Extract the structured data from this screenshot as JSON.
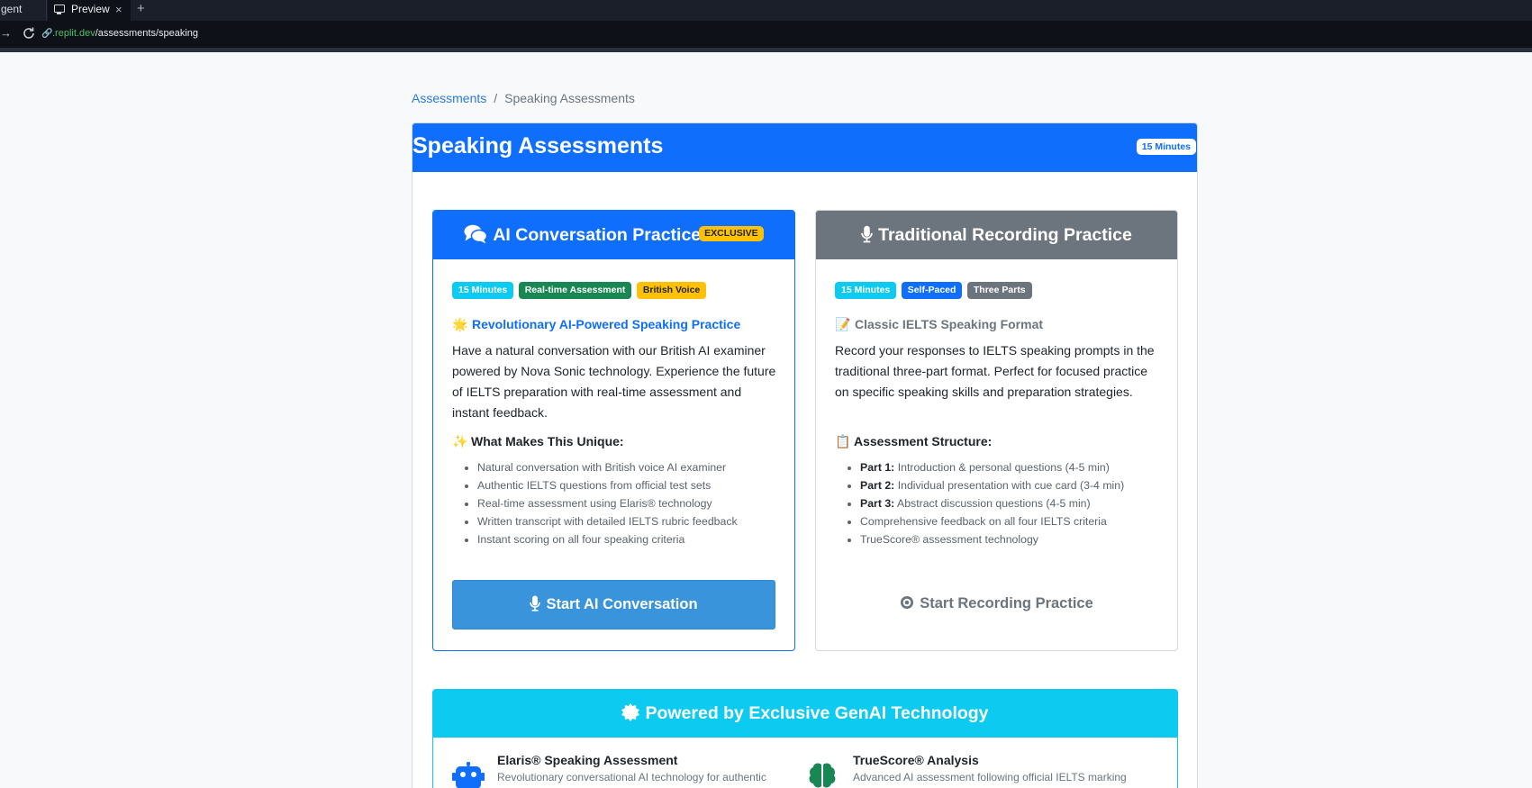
{
  "browser": {
    "partial_tab_label": "gent",
    "active_tab_label": "Preview",
    "tab_close": "×",
    "new_tab": "+",
    "forward_glyph": "→",
    "url_domain": ".replit.dev",
    "url_path": "/assessments/speaking"
  },
  "breadcrumb": {
    "root": "Assessments",
    "separator": "/",
    "current": "Speaking Assessments"
  },
  "main": {
    "title": "Speaking Assessments",
    "duration_badge": "15 Minutes"
  },
  "ai_option": {
    "title": "AI Conversation Practice",
    "exclusive_badge": "EXCLUSIVE",
    "tags": [
      "15 Minutes",
      "Real-time Assessment",
      "British Voice"
    ],
    "subhead": "Revolutionary AI-Powered Speaking Practice",
    "subhead_emoji": "🌟",
    "description": "Have a natural conversation with our British AI examiner powered by Nova Sonic technology. Experience the future of IELTS preparation with real-time assessment and instant feedback.",
    "features_title": "What Makes This Unique:",
    "features_emoji": "✨",
    "features": [
      "Natural conversation with British voice AI examiner",
      "Authentic IELTS questions from official test sets",
      "Real-time assessment using Elaris® technology",
      "Written transcript with detailed IELTS rubric feedback",
      "Instant scoring on all four speaking criteria"
    ],
    "button_label": "Start AI Conversation"
  },
  "traditional_option": {
    "title": "Traditional Recording Practice",
    "tags": [
      "15 Minutes",
      "Self-Paced",
      "Three Parts"
    ],
    "subhead": "Classic IELTS Speaking Format",
    "subhead_emoji": "📝",
    "description": "Record your responses to IELTS speaking prompts in the traditional three-part format. Perfect for focused practice on specific speaking skills and preparation strategies.",
    "structure_title": "Assessment Structure:",
    "structure_emoji": "📋",
    "structure": [
      {
        "bold": "Part 1:",
        "text": " Introduction & personal questions (4-5 min)"
      },
      {
        "bold": "Part 2:",
        "text": " Individual presentation with cue card (3-4 min)"
      },
      {
        "bold": "Part 3:",
        "text": " Abstract discussion questions (4-5 min)"
      },
      {
        "bold": "",
        "text": "Comprehensive feedback on all four IELTS criteria"
      },
      {
        "bold": "",
        "text": "TrueScore® assessment technology"
      }
    ],
    "button_label": "Start Recording Practice"
  },
  "tech": {
    "title": "Powered by Exclusive GenAI Technology",
    "items": [
      {
        "name": "Elaris® Speaking Assessment",
        "desc": "Revolutionary conversational AI technology for authentic",
        "icon": "robot-icon"
      },
      {
        "name": "TrueScore® Analysis",
        "desc": "Advanced AI assessment following official IELTS marking",
        "icon": "brain-icon"
      }
    ]
  },
  "colors": {
    "primary": "#0f6efc",
    "secondary": "#6c757d",
    "info": "#0dcaf0",
    "success": "#198754",
    "warning": "#ffc107",
    "button_ai": "#3a94dc"
  }
}
